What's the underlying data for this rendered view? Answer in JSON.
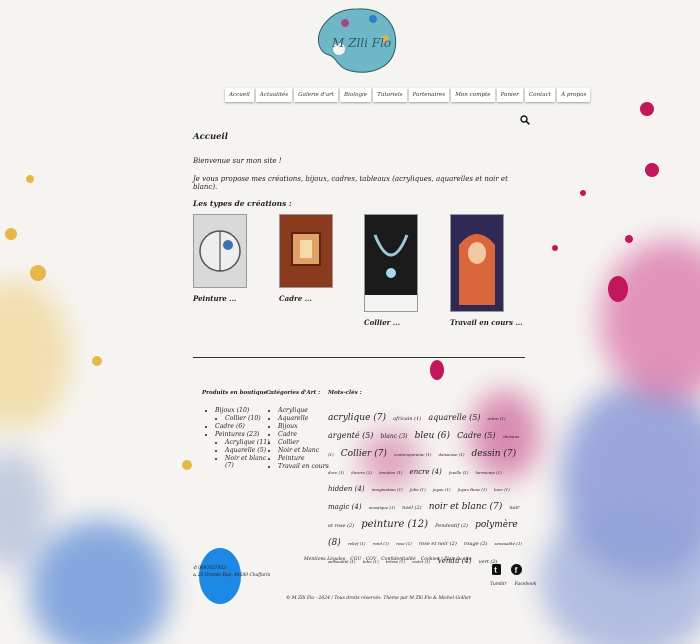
{
  "logo": {
    "text": "M Zlli Flo"
  },
  "nav": [
    "Accueil",
    "Actualités",
    "Galerie d'art",
    "Biologie",
    "Tutoriels",
    "Partenaires",
    "Mon compte",
    "Panier",
    "Contact",
    "À propos"
  ],
  "content": {
    "title": "Accueil",
    "welcome": "Bienvenue sur mon site !",
    "intro": "Je vous propose mes créations, bijoux, cadres, tableaux (acryliques, aquarelles et noir et blanc).",
    "types_title": "Les types de créations :",
    "cards": [
      {
        "label": "Peinture ...",
        "bg": "#d9d9d9"
      },
      {
        "label": "Cadre ...",
        "bg": "#8a3b1d"
      },
      {
        "label": "Collier ...",
        "bg": "#1a1a1a"
      },
      {
        "label": "Travail en cours ...",
        "bg": "#2f2a55"
      }
    ]
  },
  "footer": {
    "col1": {
      "title": "Produits en boutique :",
      "items": [
        {
          "label": "Bijoux (10)"
        },
        {
          "label": "Collier (10)",
          "sub": true
        },
        {
          "label": "Cadre (6)"
        },
        {
          "label": "Peintures (23)"
        },
        {
          "label": "Acrylique (11)",
          "sub": true
        },
        {
          "label": "Aquarelle (5)",
          "sub": true
        },
        {
          "label": "Noir et blanc (7)",
          "sub": true
        }
      ]
    },
    "col2": {
      "title": "Catégories d'Art :",
      "items": [
        "Acrylique",
        "Aquarelle",
        "Bijoux",
        "Cadre",
        "Collier",
        "Noir et blanc",
        "Peinture",
        "Travail en cours"
      ]
    },
    "col3": {
      "title": "Mots-clés :",
      "tags": [
        {
          "t": "acrylique (7)",
          "s": 9
        },
        {
          "t": "africain (1)",
          "s": 5
        },
        {
          "t": "aquarelle (5)",
          "s": 8
        },
        {
          "t": "arbre (1)",
          "s": 4
        },
        {
          "t": "argenté (5)",
          "s": 8
        },
        {
          "t": "blanc (3)",
          "s": 6
        },
        {
          "t": "bleu (6)",
          "s": 9
        },
        {
          "t": "Cadre (5)",
          "s": 8
        },
        {
          "t": "chevaux (1)",
          "s": 4
        },
        {
          "t": "Collier (7)",
          "s": 9
        },
        {
          "t": "contemporaine (1)",
          "s": 4
        },
        {
          "t": "danseuse (1)",
          "s": 4
        },
        {
          "t": "dessin (7)",
          "s": 9
        },
        {
          "t": "dore (1)",
          "s": 4
        },
        {
          "t": "dorure (1)",
          "s": 4
        },
        {
          "t": "émotion (1)",
          "s": 4
        },
        {
          "t": "encre (4)",
          "s": 7
        },
        {
          "t": "feuille (1)",
          "s": 4
        },
        {
          "t": "harmonie (1)",
          "s": 4
        },
        {
          "t": "hidden (4)",
          "s": 7
        },
        {
          "t": "imagination (1)",
          "s": 4
        },
        {
          "t": "Jolie (1)",
          "s": 4
        },
        {
          "t": "joyau (1)",
          "s": 4
        },
        {
          "t": "Joyau Rose (1)",
          "s": 4
        },
        {
          "t": "lune (1)",
          "s": 4
        },
        {
          "t": "magic (4)",
          "s": 7
        },
        {
          "t": "mosaïque (1)",
          "s": 4
        },
        {
          "t": "noel (2)",
          "s": 5
        },
        {
          "t": "noir et blanc (7)",
          "s": 9
        },
        {
          "t": "noir et rose (2)",
          "s": 5
        },
        {
          "t": "peinture (12)",
          "s": 10
        },
        {
          "t": "Pendentif (2)",
          "s": 5
        },
        {
          "t": "polymère (8)",
          "s": 9
        },
        {
          "t": "relief (1)",
          "s": 4
        },
        {
          "t": "rond (1)",
          "s": 4
        },
        {
          "t": "rose (1)",
          "s": 4
        },
        {
          "t": "rose et noir (2)",
          "s": 5
        },
        {
          "t": "rouge (2)",
          "s": 5
        },
        {
          "t": "sensualité (1)",
          "s": 4
        },
        {
          "t": "sensualité (1)",
          "s": 4
        },
        {
          "t": "tube (1)",
          "s": 4
        },
        {
          "t": "tresse (1)",
          "s": 4
        },
        {
          "t": "violet (1)",
          "s": 4
        },
        {
          "t": "Vendu (4)",
          "s": 7
        },
        {
          "t": "vert (2)",
          "s": 5
        }
      ]
    }
  },
  "footer_links": [
    "Mentions Légales",
    "CGU - CGV",
    "Confidentialité",
    "Cookies",
    "Plan du site"
  ],
  "contact": {
    "phone": "✆ 0697657953",
    "address": "⌂ 25 Grande Rue, 44580 Chaffarin"
  },
  "social": {
    "tumblr": "Tumblr",
    "facebook": "Facebook"
  },
  "copyright": "© M Zlli Flo - 2024 / Tous droits réservés. Thème par M Zlli Flo & Michel Gollier",
  "colors": {
    "accent": "#2b5d6a",
    "splash_pink": "#c2185b",
    "splash_blue": "#1976d2",
    "splash_yellow": "#e6b84a"
  }
}
